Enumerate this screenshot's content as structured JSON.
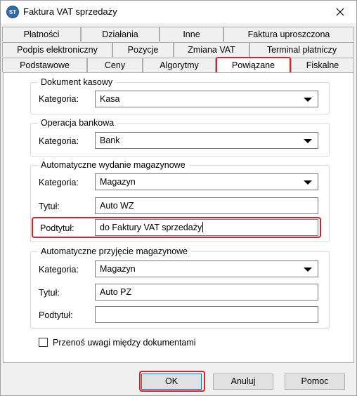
{
  "window": {
    "icon_text": "ST",
    "title": "Faktura VAT sprzedaży"
  },
  "tabs": {
    "row1": [
      "Płatności",
      "Działania",
      "Inne",
      "Faktura uproszczona"
    ],
    "row2": [
      "Podpis elektroniczny",
      "Pozycje",
      "Zmiana VAT",
      "Terminal płatniczy"
    ],
    "row3": [
      "Podstawowe",
      "Ceny",
      "Algorytmy",
      "Powiązane",
      "Fiskalne"
    ],
    "active": "Powiązane"
  },
  "sections": {
    "cash_doc": {
      "title": "Dokument kasowy",
      "category_label": "Kategoria:",
      "category_value": "Kasa"
    },
    "bank_op": {
      "title": "Operacja bankowa",
      "category_label": "Kategoria:",
      "category_value": "Bank"
    },
    "auto_issue": {
      "title": "Automatyczne wydanie magazynowe",
      "category_label": "Kategoria:",
      "category_value": "Magazyn",
      "title_label": "Tytuł:",
      "title_value": "Auto WZ",
      "subtitle_label": "Podtytuł:",
      "subtitle_value": "do Faktury VAT sprzedaży"
    },
    "auto_receipt": {
      "title": "Automatyczne przyjęcie magazynowe",
      "category_label": "Kategoria:",
      "category_value": "Magazyn",
      "title_label": "Tytuł:",
      "title_value": "Auto PZ",
      "subtitle_label": "Podtytuł:",
      "subtitle_value": ""
    }
  },
  "checkbox": {
    "label": "Przenoś uwagi między dokumentami",
    "checked": false
  },
  "buttons": {
    "ok": "OK",
    "cancel": "Anuluj",
    "help": "Pomoc"
  },
  "colors": {
    "highlight": "#d92128",
    "title_bar": "#ffffff",
    "dialog_bg": "#f0f0f0"
  }
}
